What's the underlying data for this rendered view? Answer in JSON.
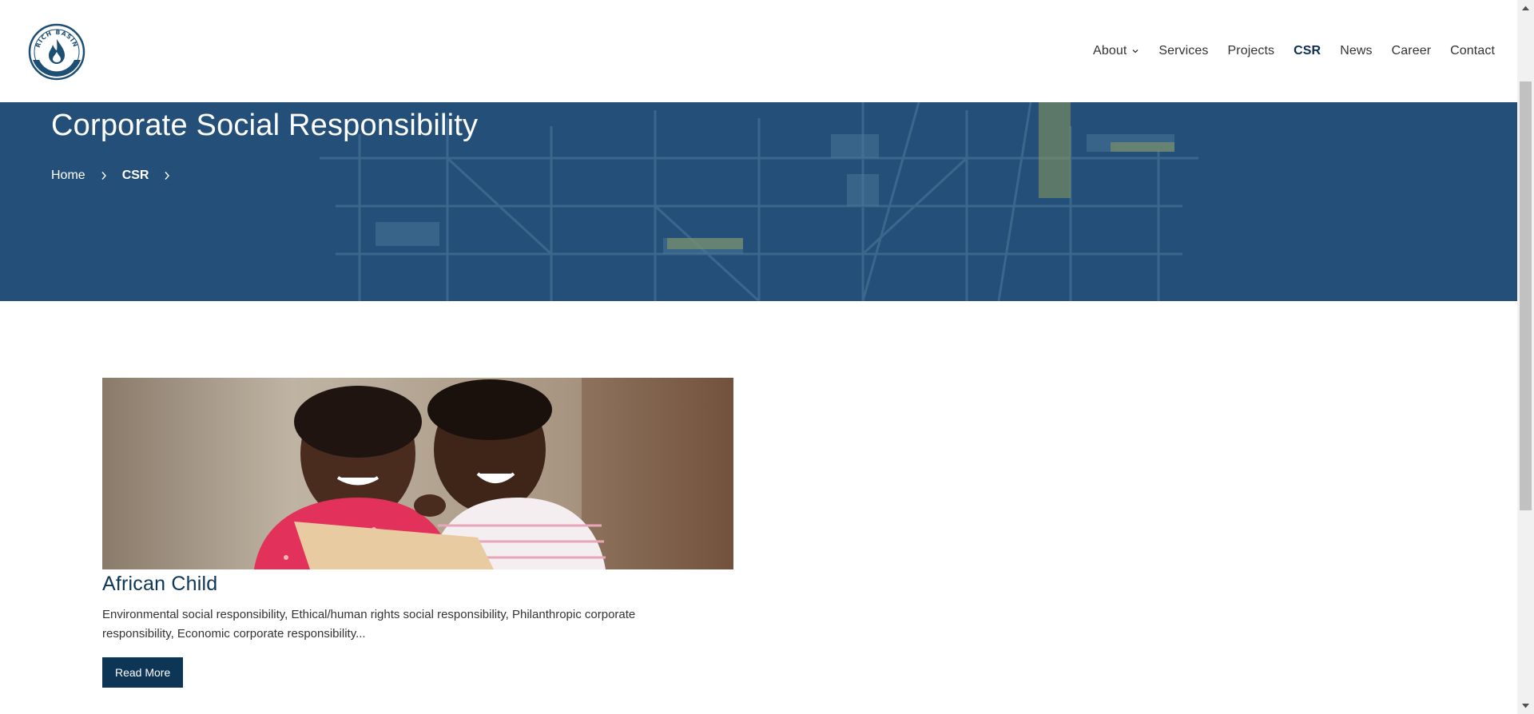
{
  "header": {
    "logo": {
      "text_top": "RICH BASIN",
      "text_bottom": "ENERGY"
    },
    "nav": [
      {
        "label": "About",
        "has_dropdown": true
      },
      {
        "label": "Services"
      },
      {
        "label": "Projects"
      },
      {
        "label": "CSR",
        "active": true
      },
      {
        "label": "News"
      },
      {
        "label": "Career"
      },
      {
        "label": "Contact"
      }
    ]
  },
  "hero": {
    "title": "Corporate Social Responsibility",
    "breadcrumb": [
      {
        "label": "Home"
      },
      {
        "label": "CSR"
      }
    ],
    "overlay_color": "#234f78"
  },
  "posts": [
    {
      "title": "African Child",
      "excerpt": "Environmental social responsibility, Ethical/human rights social responsibility, Philanthropic corporate responsibility, Economic corporate responsibility...",
      "button_label": "Read More"
    }
  ],
  "colors": {
    "brand_navy": "#0d3556",
    "hero_blue": "#234f78"
  }
}
